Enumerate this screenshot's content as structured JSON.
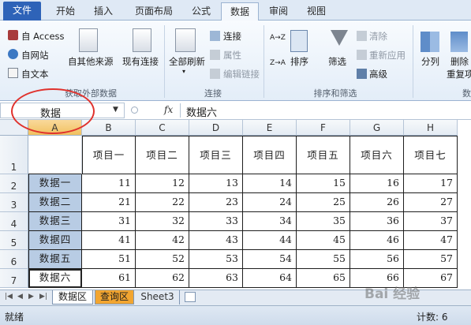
{
  "ribbon_tabs": [
    "文件",
    "开始",
    "插入",
    "页面布局",
    "公式",
    "数据",
    "审阅",
    "视图"
  ],
  "active_tab": "数据",
  "ribbon": {
    "external": {
      "access": "自 Access",
      "web": "自网站",
      "text": "自文本",
      "other": "自其他来源",
      "existing": "现有连接",
      "label": "获取外部数据"
    },
    "connections": {
      "refresh_all": "全部刷新",
      "connections": "连接",
      "properties": "属性",
      "edit_links": "编辑链接",
      "label": "连接"
    },
    "sort_filter": {
      "sort_az": "A→Z",
      "sort_za": "Z→A",
      "sort": "排序",
      "filter": "筛选",
      "clear": "清除",
      "reapply": "重新应用",
      "advanced": "高级",
      "label": "排序和筛选"
    },
    "tools": {
      "split": "分列",
      "remove_dup": "删除",
      "remove_dup2": "重复项",
      "trailing": "数"
    }
  },
  "formula_bar": {
    "name_box": "数据",
    "fx": "fx",
    "content": "数据六"
  },
  "columns": [
    "A",
    "B",
    "C",
    "D",
    "E",
    "F",
    "G",
    "H"
  ],
  "rows": [
    "1",
    "2",
    "3",
    "4",
    "5",
    "6",
    "7"
  ],
  "headers": [
    "项目一",
    "项目二",
    "项目三",
    "项目四",
    "项目五",
    "项目六",
    "项目七"
  ],
  "labels": [
    "数据一",
    "数据二",
    "数据三",
    "数据四",
    "数据五",
    "数据六"
  ],
  "values": [
    [
      "11",
      "12",
      "13",
      "14",
      "15",
      "16",
      "17"
    ],
    [
      "21",
      "22",
      "23",
      "24",
      "25",
      "26",
      "27"
    ],
    [
      "31",
      "32",
      "33",
      "34",
      "35",
      "36",
      "37"
    ],
    [
      "41",
      "42",
      "43",
      "44",
      "45",
      "46",
      "47"
    ],
    [
      "51",
      "52",
      "53",
      "54",
      "55",
      "56",
      "57"
    ],
    [
      "61",
      "62",
      "63",
      "64",
      "65",
      "66",
      "67"
    ]
  ],
  "sheet_tabs": [
    "数据区",
    "查询区",
    "Sheet3"
  ],
  "status": {
    "left": "就绪",
    "right": "计数: 6"
  },
  "watermark": "Bai 经验",
  "colors": {
    "file_tab": "#2e63b8",
    "label_fill": "#b8cce4",
    "annotation": "#e0322d",
    "query_tab": "#f2a530"
  }
}
